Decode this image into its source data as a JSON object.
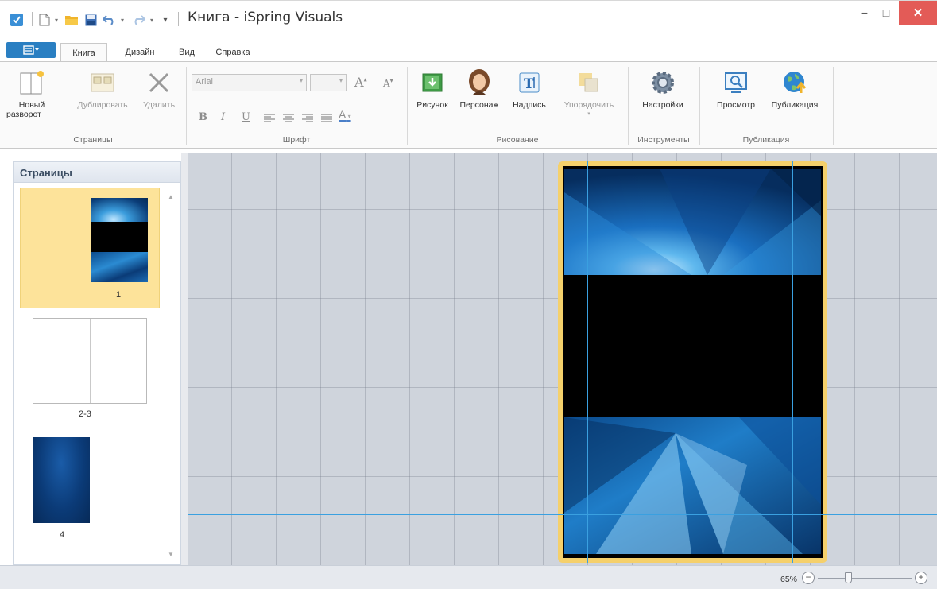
{
  "window": {
    "title": "Книга - iSpring Visuals",
    "minimize_glyph": "−",
    "maximize_glyph": "□",
    "close_glyph": "✕"
  },
  "quick_access": {
    "icons": [
      "app-icon",
      "new-file-icon",
      "open-folder-icon",
      "save-icon",
      "undo-icon",
      "redo-icon",
      "customize-icon"
    ]
  },
  "tabs": [
    {
      "label": "Книга",
      "active": true
    },
    {
      "label": "Дизайн",
      "active": false
    },
    {
      "label": "Вид",
      "active": false
    },
    {
      "label": "Справка",
      "active": false
    }
  ],
  "ribbon": {
    "pages_group": {
      "label": "Страницы",
      "new_spread": "Новый разворот",
      "new_spread_line1": "Новый",
      "new_spread_line2": "разворот",
      "duplicate": "Дублировать",
      "delete": "Удалить"
    },
    "font_group": {
      "label": "Шрифт",
      "font_name": "Arial",
      "font_size": "",
      "grow_glyph": "A",
      "shrink_glyph": "A",
      "bold": "B",
      "italic": "I",
      "underline": "U",
      "font_color": "A"
    },
    "drawing_group": {
      "label": "Рисование",
      "picture": "Рисунок",
      "character": "Персонаж",
      "caption": "Надпись",
      "arrange": "Упорядочить"
    },
    "tools_group": {
      "label": "Инструменты",
      "settings": "Настройки"
    },
    "publish_group": {
      "label": "Публикация",
      "preview": "Просмотр",
      "publish": "Публикация"
    }
  },
  "pages_panel": {
    "title": "Страницы",
    "thumbnails": [
      {
        "number": "1",
        "selected": true
      },
      {
        "number": "2-3",
        "selected": false
      },
      {
        "number": "4",
        "selected": false
      }
    ]
  },
  "statusbar": {
    "zoom": "65%",
    "zoom_level": 0.65
  },
  "colors": {
    "accent": "#2a7fc2",
    "selection": "#fde39a",
    "page_border": "#f5d06b",
    "guide": "#3aa0e0",
    "close": "#e35b57"
  }
}
